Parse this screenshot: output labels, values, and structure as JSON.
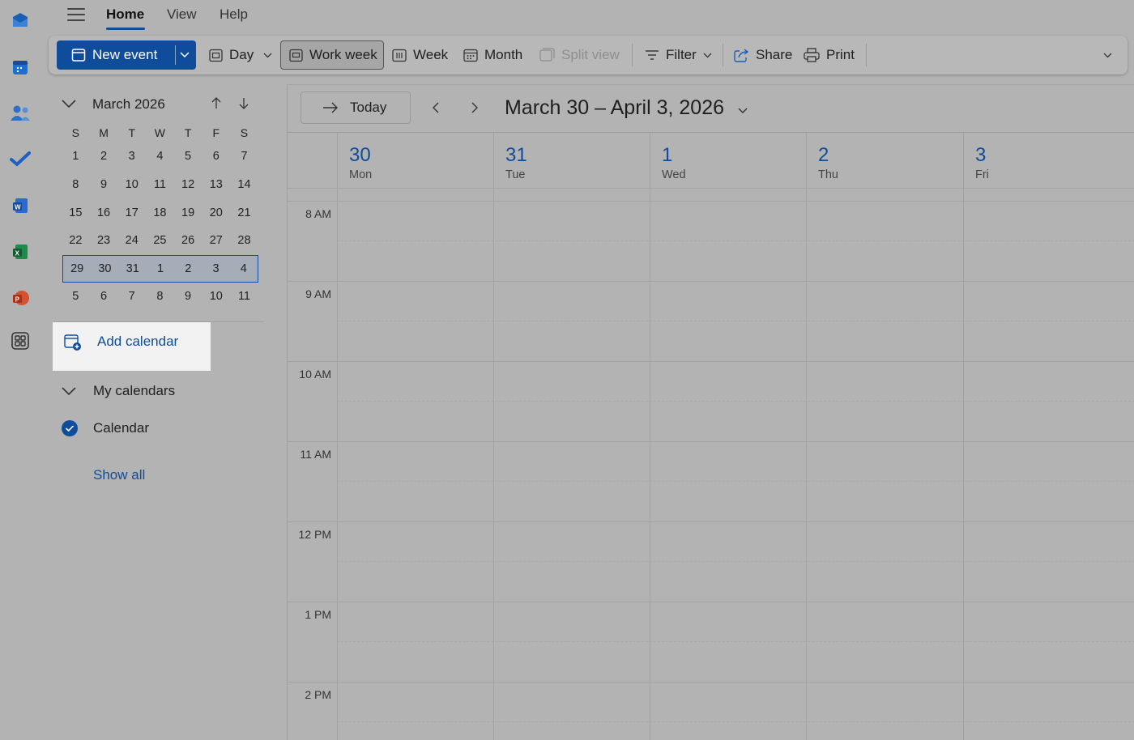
{
  "top_menu": {
    "tabs": [
      "Home",
      "View",
      "Help"
    ],
    "active": "Home"
  },
  "ribbon": {
    "new_event": "New event",
    "day": "Day",
    "work_week": "Work week",
    "week": "Week",
    "month": "Month",
    "split_view": "Split view",
    "filter": "Filter",
    "share": "Share",
    "print": "Print"
  },
  "mini_calendar": {
    "title": "March 2026",
    "dow": [
      "S",
      "M",
      "T",
      "W",
      "T",
      "F",
      "S"
    ],
    "weeks": [
      [
        "1",
        "2",
        "3",
        "4",
        "5",
        "6",
        "7"
      ],
      [
        "8",
        "9",
        "10",
        "11",
        "12",
        "13",
        "14"
      ],
      [
        "15",
        "16",
        "17",
        "18",
        "19",
        "20",
        "21"
      ],
      [
        "22",
        "23",
        "24",
        "25",
        "26",
        "27",
        "28"
      ],
      [
        "29",
        "30",
        "31",
        "1",
        "2",
        "3",
        "4"
      ],
      [
        "5",
        "6",
        "7",
        "8",
        "9",
        "10",
        "11"
      ]
    ],
    "selected_week_index": 4
  },
  "left_pane": {
    "add_calendar": "Add calendar",
    "my_calendars": "My calendars",
    "calendar_item": "Calendar",
    "show_all": "Show all"
  },
  "main": {
    "today": "Today",
    "range_title": "March 30 – April 3, 2026",
    "days": [
      {
        "num": "30",
        "name": "Mon"
      },
      {
        "num": "31",
        "name": "Tue"
      },
      {
        "num": "1",
        "name": "Wed"
      },
      {
        "num": "2",
        "name": "Thu"
      },
      {
        "num": "3",
        "name": "Fri"
      }
    ],
    "times": [
      "8 AM",
      "9 AM",
      "10 AM",
      "11 AM",
      "12 PM",
      "1 PM",
      "2 PM"
    ]
  },
  "colors": {
    "accent": "#0f4c9b",
    "background": "#b3b3b3",
    "highlight": "#f2f2f2"
  }
}
